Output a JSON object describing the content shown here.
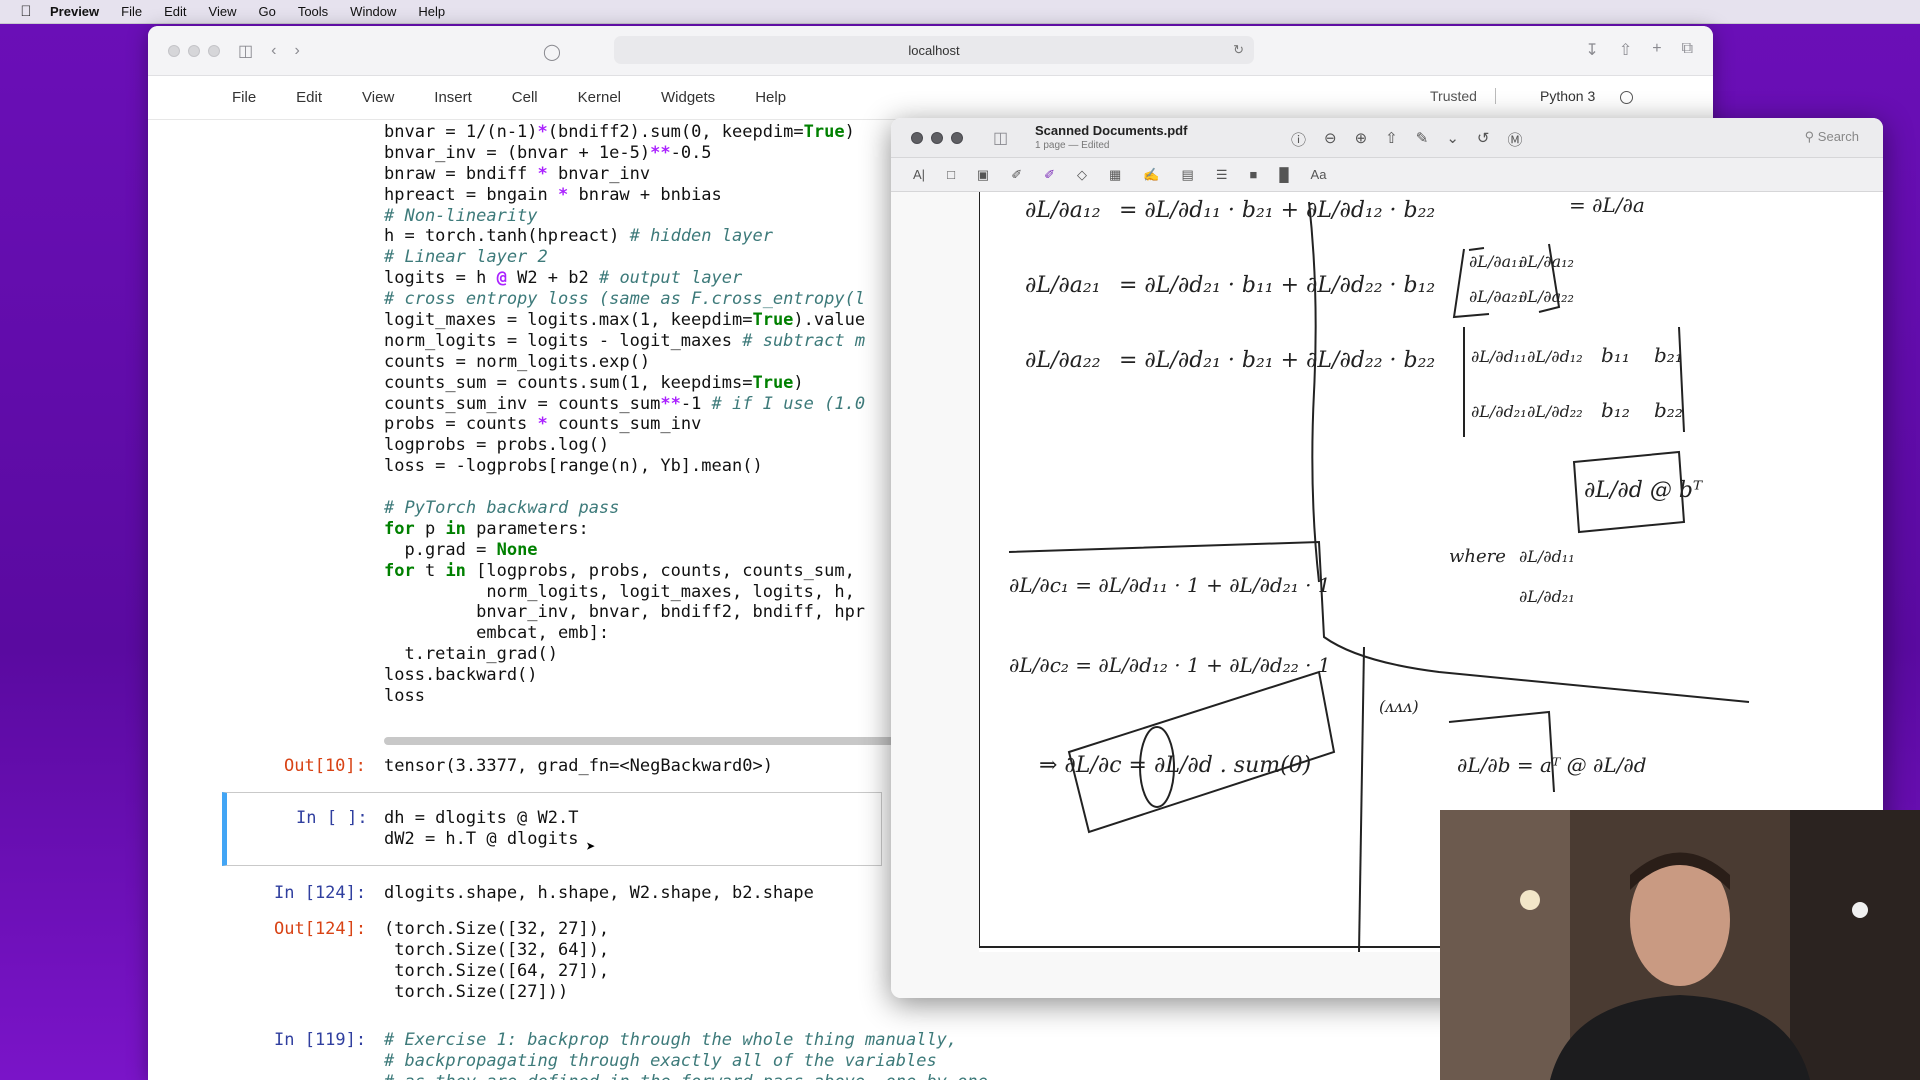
{
  "menubar": {
    "app": "Preview",
    "items": [
      "File",
      "Edit",
      "View",
      "Go",
      "Tools",
      "Window",
      "Help"
    ]
  },
  "browser": {
    "address": "localhost"
  },
  "jupyter": {
    "menu": [
      "File",
      "Edit",
      "View",
      "Insert",
      "Cell",
      "Kernel",
      "Widgets",
      "Help"
    ],
    "trusted": "Trusted",
    "kernel": "Python 3"
  },
  "cells": {
    "forward_code": [
      "bnvar = 1/(n-1)*(bndiff2).sum(0, keepdim=True)",
      "bnvar_inv = (bnvar + 1e-5)**-0.5",
      "bnraw = bndiff * bnvar_inv",
      "hpreact = bngain * bnraw + bnbias",
      "# Non-linearity",
      "h = torch.tanh(hpreact) # hidden layer",
      "# Linear layer 2",
      "logits = h @ W2 + b2 # output layer",
      "# cross entropy loss (same as F.cross_entropy(l",
      "logit_maxes = logits.max(1, keepdim=True).value",
      "norm_logits = logits - logit_maxes # subtract m",
      "counts = norm_logits.exp()",
      "counts_sum = counts.sum(1, keepdims=True)",
      "counts_sum_inv = counts_sum**-1 # if I use (1.0",
      "probs = counts * counts_sum_inv",
      "logprobs = probs.log()",
      "loss = -logprobs[range(n), Yb].mean()",
      "",
      "# PyTorch backward pass",
      "for p in parameters:",
      "  p.grad = None",
      "for t in [logprobs, probs, counts, counts_sum,",
      "          norm_logits, logit_maxes, logits, h,",
      "         bnvar_inv, bnvar, bndiff2, bndiff, hpr",
      "         embcat, emb]:",
      "  t.retain_grad()",
      "loss.backward()",
      "loss"
    ],
    "out10_prompt": "Out[10]:",
    "out10_text": "tensor(3.3377, grad_fn=<NegBackward0>)",
    "active_prompt": "In [ ]:",
    "active_code": [
      "dh = dlogits @ W2.T",
      "dW2 = h.T @ dlogits"
    ],
    "in124_prompt": "In [124]:",
    "in124_code": "dlogits.shape, h.shape, W2.shape, b2.shape",
    "out124_prompt": "Out[124]:",
    "out124_text": [
      "(torch.Size([32, 27]),",
      " torch.Size([32, 64]),",
      " torch.Size([64, 27]),",
      " torch.Size([27]))"
    ],
    "in119_prompt": "In [119]:",
    "in119_code": [
      "# Exercise 1: backprop through the whole thing manually,",
      "# backpropagating through exactly all of the variables",
      "# as they are defined in the forward pass above, one by one"
    ]
  },
  "preview": {
    "title": "Scanned Documents.pdf",
    "subtitle": "1 page — Edited",
    "search_placeholder": "Search",
    "markup_text_label": "Aa",
    "text_select_label": "A|"
  },
  "handwriting": {
    "eq_a12_lhs": "∂L/∂a₁₂",
    "eq_a12_rhs": "= ∂L/∂d₁₁ · b₂₁ + ∂L/∂d₁₂ · b₂₂",
    "eq_a21_lhs": "∂L/∂a₂₁",
    "eq_a21_rhs": "= ∂L/∂d₂₁ · b₁₁ + ∂L/∂d₂₂ · b₁₂",
    "eq_a22_lhs": "∂L/∂a₂₂",
    "eq_a22_rhs": "= ∂L/∂d₂₁ · b₂₁ + ∂L/∂d₂₂ · b₂₂",
    "eq_top_right": "= ∂L/∂a",
    "grad_matrix": [
      "∂L/∂a₁₁",
      "∂L/∂a₁₂",
      "∂L/∂a₂₁",
      "∂L/∂a₂₂"
    ],
    "d_matrix": [
      "∂L/∂d₁₁",
      "∂L/∂d₁₂",
      "∂L/∂d₂₁",
      "∂L/∂d₂₂"
    ],
    "b_matrix": [
      "b₁₁",
      "b₂₁",
      "b₁₂",
      "b₂₂"
    ],
    "result": "∂L/∂d @ bᵀ",
    "where": "where",
    "eq_c1": "∂L/∂c₁ = ∂L/∂d₁₁ · 1 + ∂L/∂d₂₁ · 1",
    "eq_c2": "∂L/∂c₂ = ∂L/∂d₁₂ · 1 + ∂L/∂d₂₂ · 1",
    "eq_c": "⇒ ∂L/∂c = ∂L/∂d . sum(0)",
    "drawn": "(ᴧᴧᴧ)",
    "eq_b": "∂L/∂b = aᵀ @ ∂L/∂d"
  },
  "colors": {
    "desktop": "#6b0fb8",
    "active_cell_border": "#42a5f5",
    "input_prompt": "#303f9f",
    "output_prompt": "#d84315"
  }
}
